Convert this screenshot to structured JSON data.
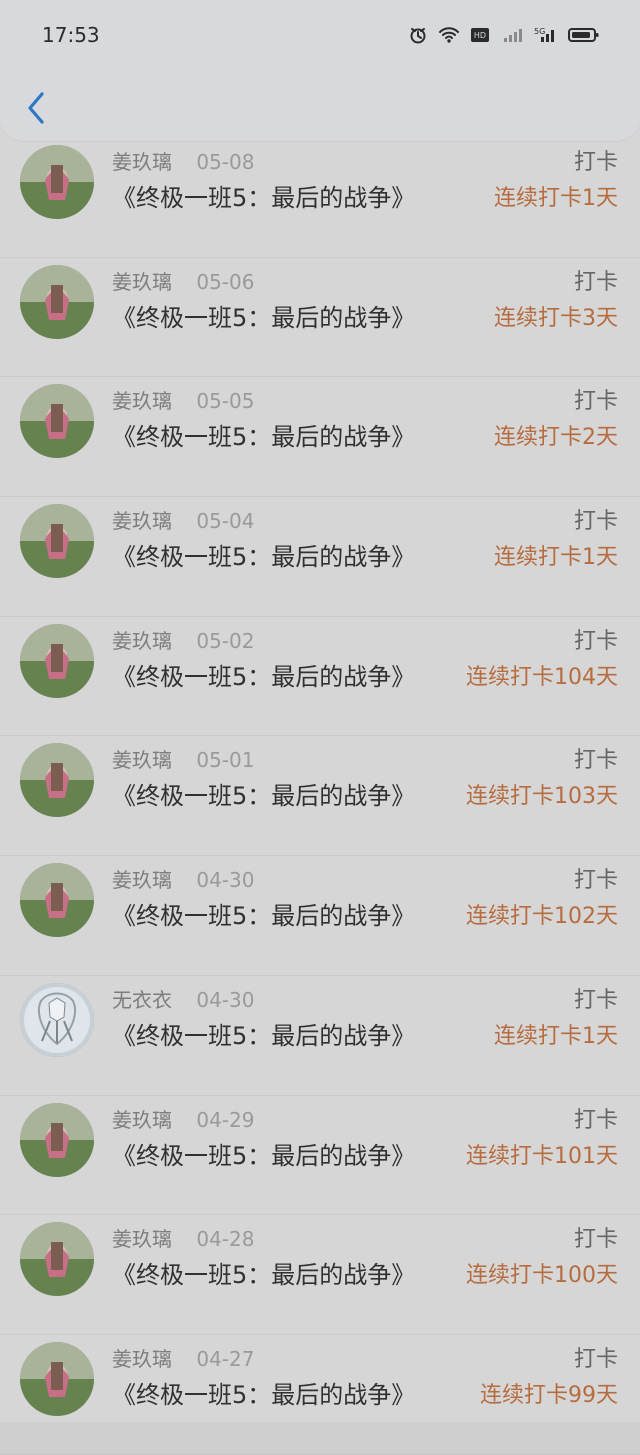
{
  "status_bar": {
    "time": "17:53",
    "icons": [
      "alarm-icon",
      "wifi-icon",
      "hd-icon",
      "signal-icon",
      "5g-icon",
      "battery-icon"
    ]
  },
  "header": {
    "back_icon": "chevron-left-icon"
  },
  "entries": [
    {
      "user": "姜玖璃",
      "date": "05-08",
      "title": "《终极一班5：最后的战争》",
      "tag": "打卡",
      "streak": "连续打卡1天",
      "avatar": "photo-avatar"
    },
    {
      "user": "姜玖璃",
      "date": "05-06",
      "title": "《终极一班5：最后的战争》",
      "tag": "打卡",
      "streak": "连续打卡3天",
      "avatar": "photo-avatar"
    },
    {
      "user": "姜玖璃",
      "date": "05-05",
      "title": "《终极一班5：最后的战争》",
      "tag": "打卡",
      "streak": "连续打卡2天",
      "avatar": "photo-avatar"
    },
    {
      "user": "姜玖璃",
      "date": "05-04",
      "title": "《终极一班5：最后的战争》",
      "tag": "打卡",
      "streak": "连续打卡1天",
      "avatar": "photo-avatar"
    },
    {
      "user": "姜玖璃",
      "date": "05-02",
      "title": "《终极一班5：最后的战争》",
      "tag": "打卡",
      "streak": "连续打卡104天",
      "avatar": "photo-avatar"
    },
    {
      "user": "姜玖璃",
      "date": "05-01",
      "title": "《终极一班5：最后的战争》",
      "tag": "打卡",
      "streak": "连续打卡103天",
      "avatar": "photo-avatar"
    },
    {
      "user": "姜玖璃",
      "date": "04-30",
      "title": "《终极一班5：最后的战争》",
      "tag": "打卡",
      "streak": "连续打卡102天",
      "avatar": "photo-avatar"
    },
    {
      "user": "无衣衣",
      "date": "04-30",
      "title": "《终极一班5：最后的战争》",
      "tag": "打卡",
      "streak": "连续打卡1天",
      "avatar": "sketch-avatar"
    },
    {
      "user": "姜玖璃",
      "date": "04-29",
      "title": "《终极一班5：最后的战争》",
      "tag": "打卡",
      "streak": "连续打卡101天",
      "avatar": "photo-avatar"
    },
    {
      "user": "姜玖璃",
      "date": "04-28",
      "title": "《终极一班5：最后的战争》",
      "tag": "打卡",
      "streak": "连续打卡100天",
      "avatar": "photo-avatar"
    },
    {
      "user": "姜玖璃",
      "date": "04-27",
      "title": "《终极一班5：最后的战争》",
      "tag": "打卡",
      "streak": "连续打卡99天",
      "avatar": "photo-avatar"
    }
  ],
  "colors": {
    "accent": "#b66c3f",
    "back": "#2d76c6",
    "text": "#313131",
    "muted": "#7d7d7d"
  }
}
